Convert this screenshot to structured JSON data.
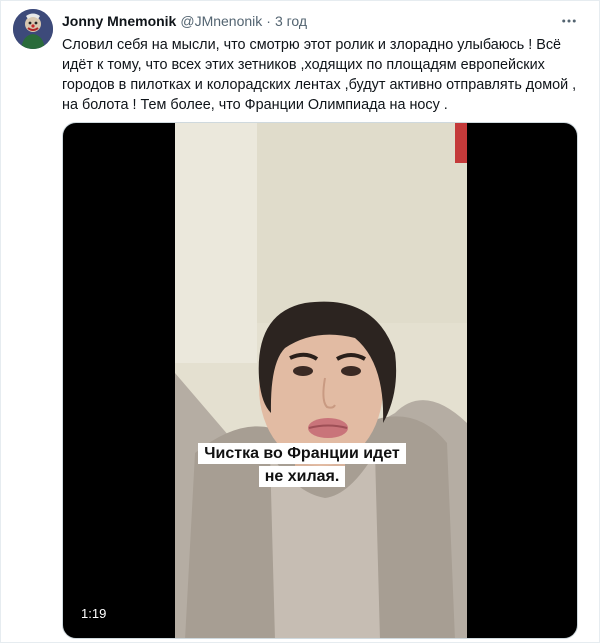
{
  "tweet": {
    "display_name": "Jonny Mnemonik",
    "handle": "@JMnenonik",
    "separator": "·",
    "time": "3 год",
    "text": "Словил себя на мысли, что смотрю этот ролик и злорадно улыбаюсь ! Всё идёт к тому, что всех этих зетников ,ходящих по площадям европейских городов в пилотках и колорадских лентах ,будут активно отправлять домой , на болота ! Тем более, что Франции Олимпиада на носу ."
  },
  "video": {
    "caption_line1": "Чистка во Франции идет",
    "caption_line2": "не хилая.",
    "duration": "1:19"
  },
  "icons": {
    "more": "more-horizontal-icon",
    "avatar": "avatar-image"
  },
  "colors": {
    "text": "#0f1419",
    "secondary": "#536471",
    "border": "#cfd9de"
  }
}
